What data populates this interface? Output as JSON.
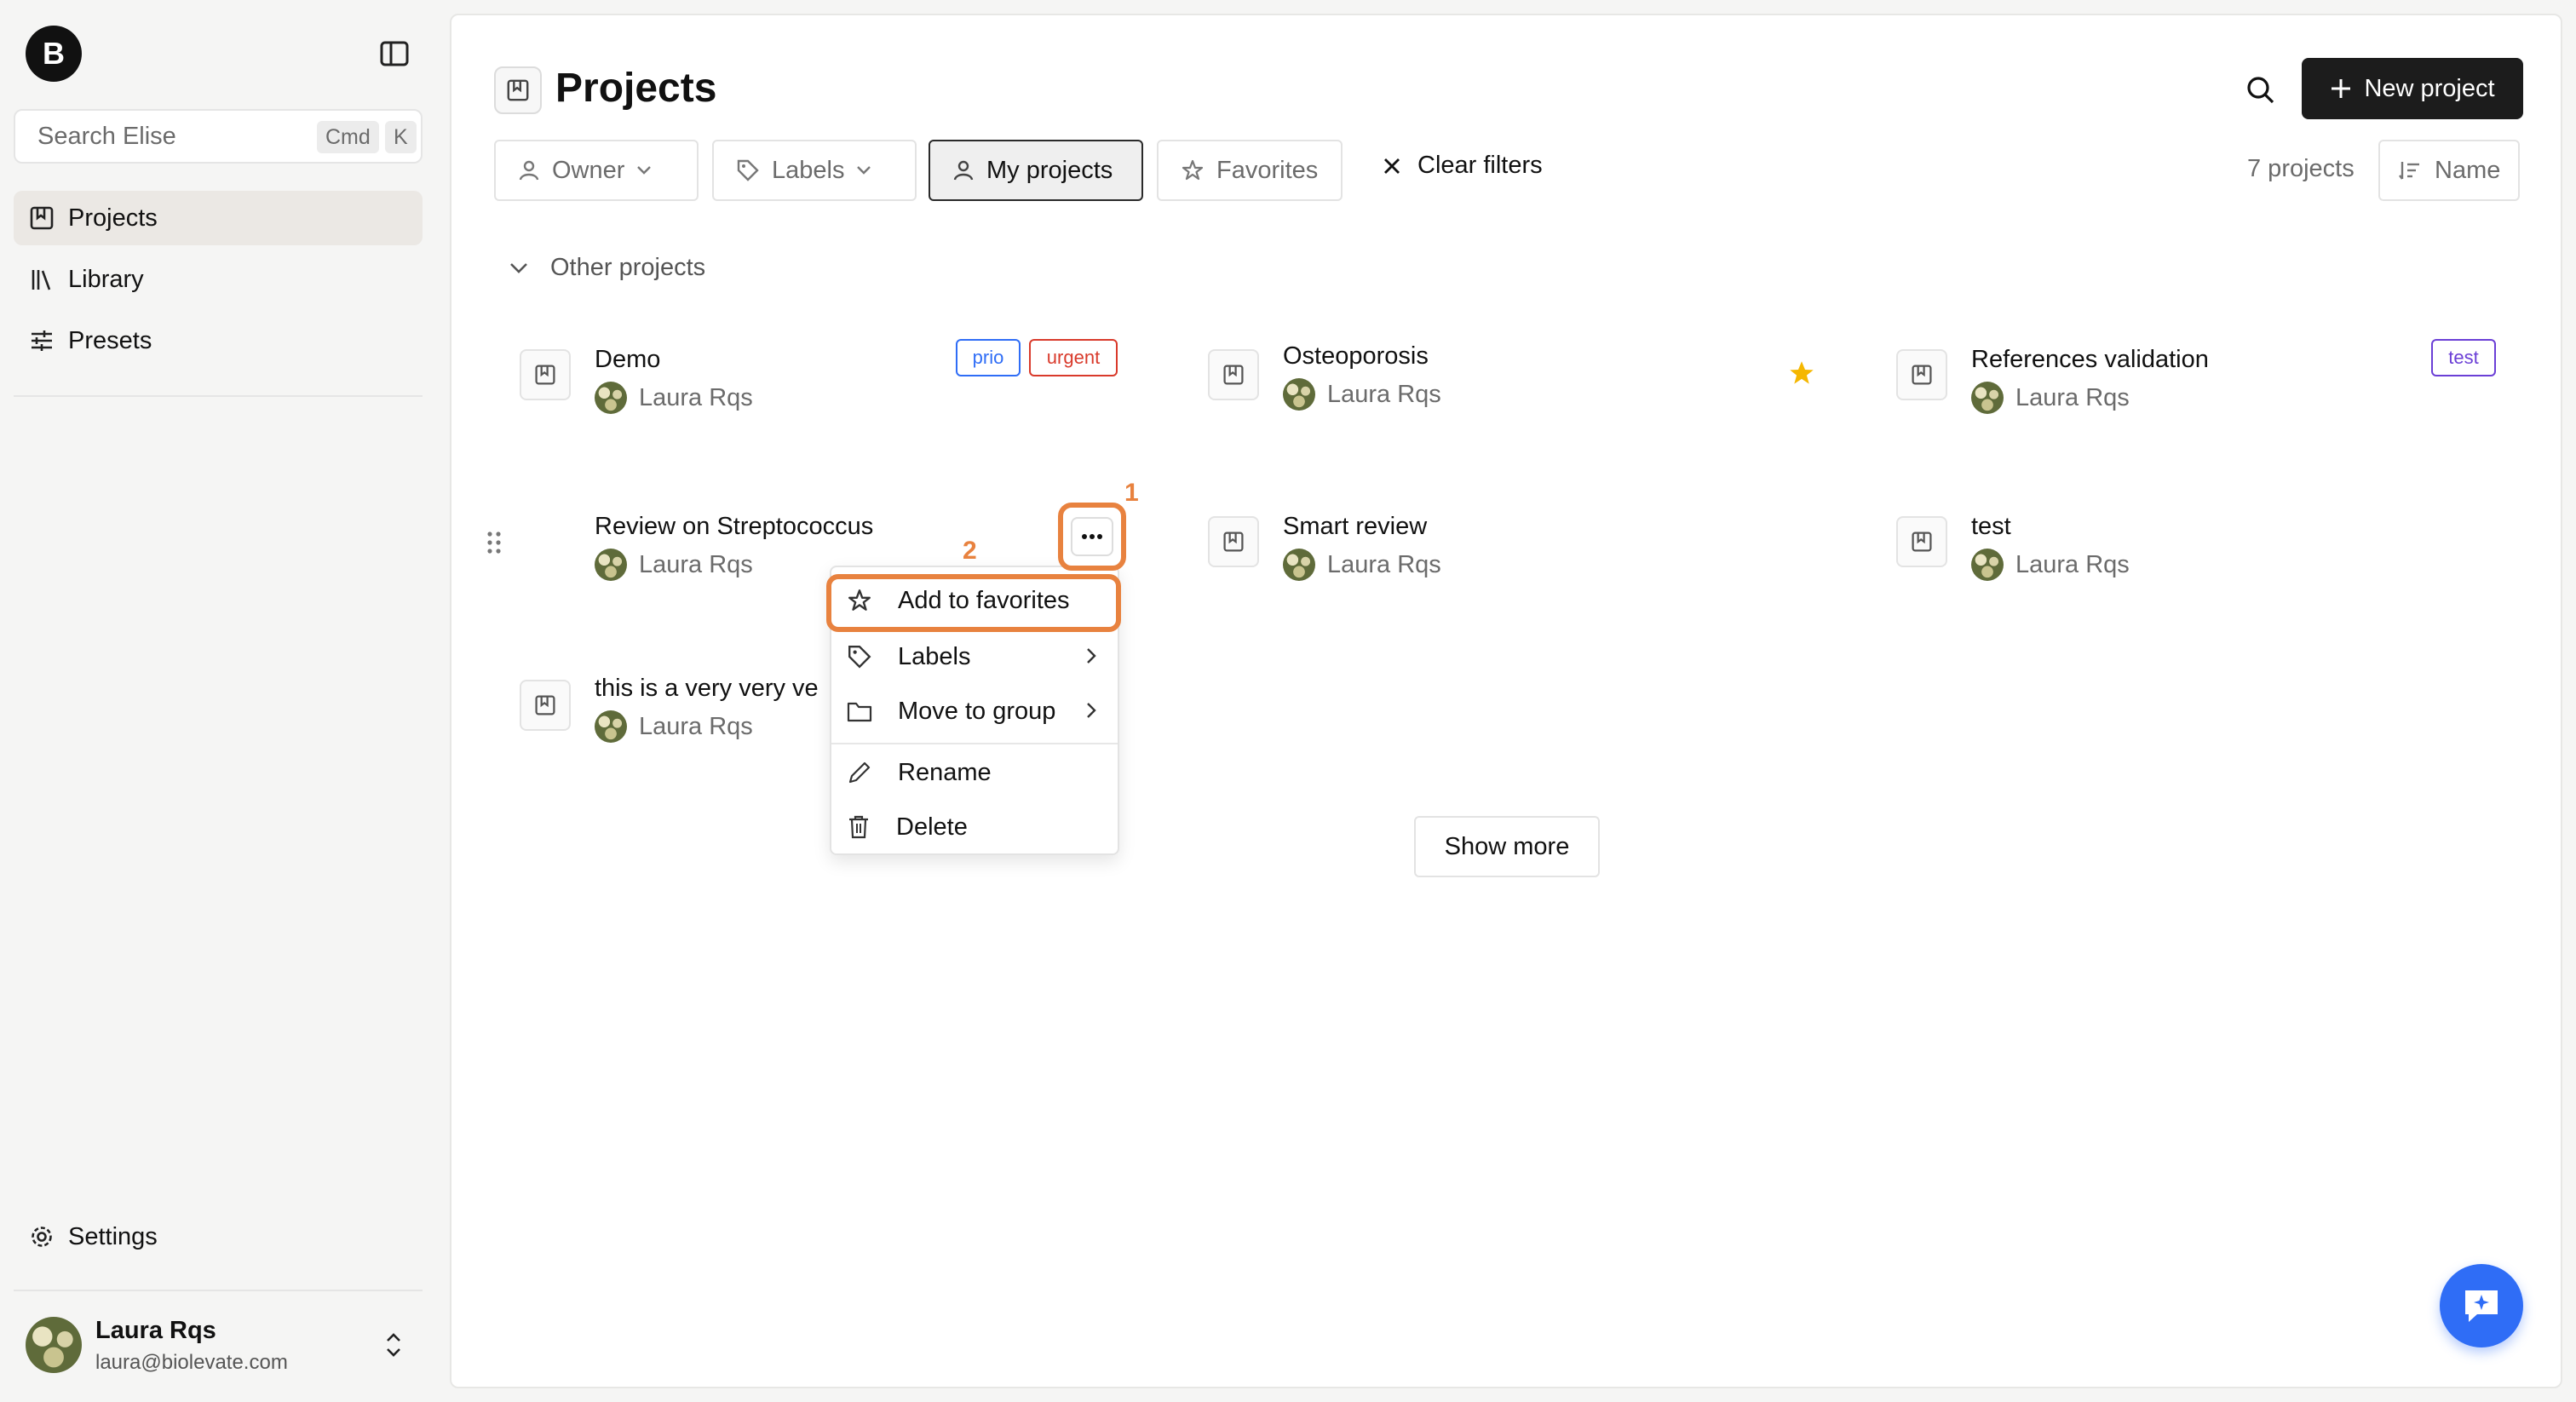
{
  "sidebar": {
    "logo_letter": "B",
    "search": {
      "placeholder": "Search Elise",
      "shortcut_mod": "Cmd",
      "shortcut_key": "K"
    },
    "items": [
      {
        "label": "Projects",
        "icon": "bookmark-square-icon",
        "active": true
      },
      {
        "label": "Library",
        "icon": "library-icon"
      },
      {
        "label": "Presets",
        "icon": "sliders-icon"
      }
    ],
    "settings_label": "Settings",
    "user": {
      "name": "Laura Rqs",
      "email": "laura@biolevate.com"
    }
  },
  "header": {
    "title": "Projects",
    "new_project_label": "New project"
  },
  "filters": {
    "owner": "Owner",
    "labels": "Labels",
    "my_projects": "My projects",
    "favorites": "Favorites",
    "clear": "Clear filters",
    "count": "7 projects",
    "sort": "Name"
  },
  "group": {
    "title": "Other projects"
  },
  "projects": [
    {
      "title": "Demo",
      "owner": "Laura Rqs",
      "tags": [
        "prio",
        "urgent"
      ]
    },
    {
      "title": "Osteoporosis",
      "owner": "Laura Rqs",
      "favorite": true
    },
    {
      "title": "References validation",
      "owner": "Laura Rqs",
      "tags": [
        "test"
      ]
    },
    {
      "title": "Review on Streptococcus",
      "owner": "Laura Rqs"
    },
    {
      "title": "Smart review",
      "owner": "Laura Rqs"
    },
    {
      "title": "test",
      "owner": "Laura Rqs"
    },
    {
      "title": "this is a very very ve",
      "owner": "Laura Rqs"
    }
  ],
  "context_menu": {
    "add_favorites": "Add to favorites",
    "labels": "Labels",
    "move_to_group": "Move to group",
    "rename": "Rename",
    "delete": "Delete"
  },
  "annotations": {
    "step1": "1",
    "step2": "2"
  },
  "show_more": "Show more",
  "colors": {
    "accent_orange": "#e8823f",
    "tag_prio": "#2f6df6",
    "tag_urgent": "#d93a2b",
    "tag_test": "#6b3fd6",
    "star": "#f5b700",
    "chat_button": "#2f6df6"
  }
}
